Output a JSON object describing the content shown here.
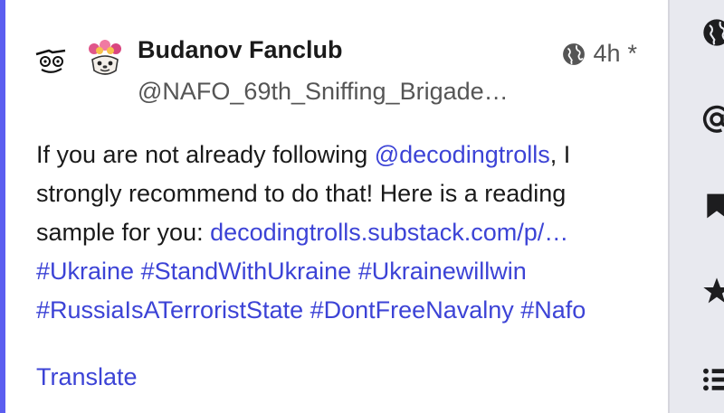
{
  "post": {
    "display_name": "Budanov Fanclub",
    "handle": "@NAFO_69th_Sniffing_Brigade…",
    "time": "4h",
    "edited_marker": "*",
    "visibility_icon": "globe-icon",
    "content": {
      "line1_prefix": "If you are not already following ",
      "mention": "@decodingtrolls",
      "line1_suffix": ", I",
      "line2": "strongly recommend to do that! Here is a reading",
      "line3_prefix": "sample for you: ",
      "url": "decodingtrolls.substack.com/p/…",
      "hashtags_line1": [
        "#Ukraine",
        "#StandWithUkraine",
        "#Ukrainewillwin"
      ],
      "hashtags_line2": [
        "#RussiaIsATerroristState",
        "#DontFreeNavalny",
        "#Nafo"
      ]
    },
    "translate_label": "Translate"
  },
  "sidebar": {
    "icons": [
      "globe-icon",
      "at-icon",
      "bookmark-icon",
      "star-icon",
      "list-icon"
    ]
  },
  "colors": {
    "accent": "#5b5ef0",
    "link": "#3c43d6",
    "sidebar_bg": "#e8e9ef"
  }
}
